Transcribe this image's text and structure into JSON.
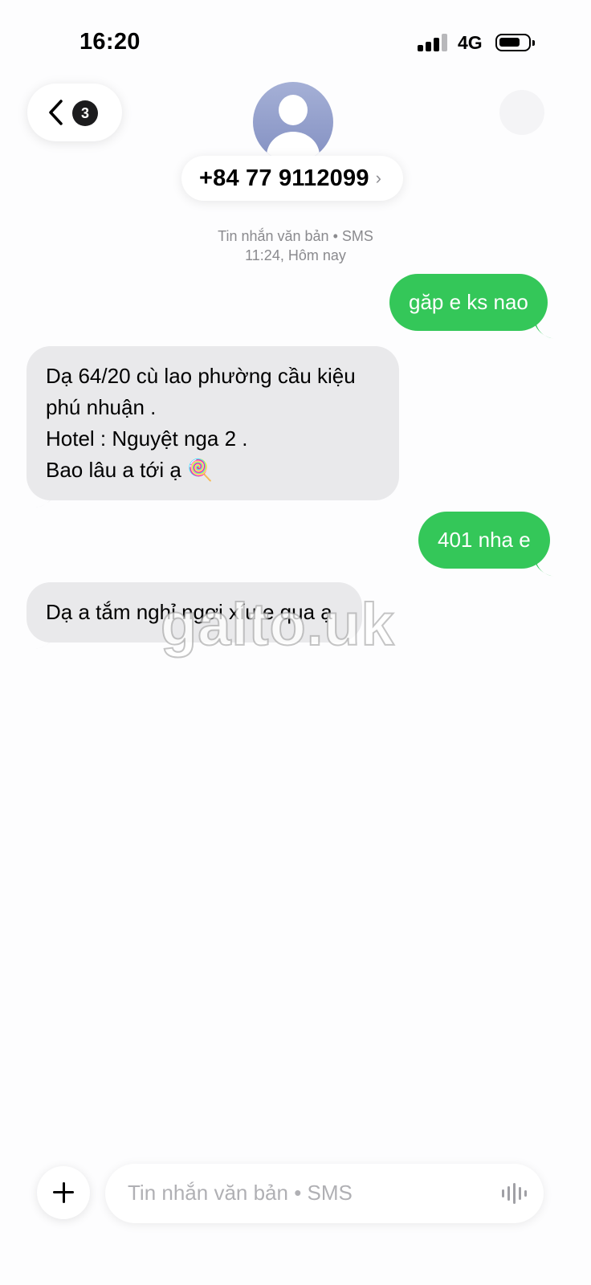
{
  "status_bar": {
    "time": "16:20",
    "network": "4G",
    "signal_bars": 3,
    "signal_max": 4
  },
  "header": {
    "back_badge": "3",
    "contact_number": "+84 77 9112099",
    "contact_chevron": "›"
  },
  "thread_meta": {
    "type_line": "Tin nhắn văn bản • SMS",
    "time_line": "11:24, Hôm nay"
  },
  "messages": [
    {
      "direction": "outgoing",
      "text": "găp e ks nao"
    },
    {
      "direction": "incoming",
      "lines": [
        "Dạ 64/20 cù lao phường cầu kiệu",
        "phú nhuận .",
        "Hotel : Nguyệt nga 2 .",
        "Bao lâu a tới ạ 🍭"
      ]
    },
    {
      "direction": "outgoing",
      "text": "401 nha e"
    },
    {
      "direction": "incoming",
      "text": "Dạ a tắm nghỉ ngơi xíu e qua ạ"
    }
  ],
  "watermark": "galto.uk",
  "input": {
    "placeholder": "Tin nhắn văn bản • SMS"
  },
  "colors": {
    "outgoing_bubble": "#34c759",
    "incoming_bubble": "#e9e9eb",
    "avatar": "#8d99c8"
  },
  "icons": [
    "back-chevron-icon",
    "person-icon",
    "plus-icon",
    "audio-waveform-icon",
    "signal-icon",
    "battery-icon"
  ]
}
